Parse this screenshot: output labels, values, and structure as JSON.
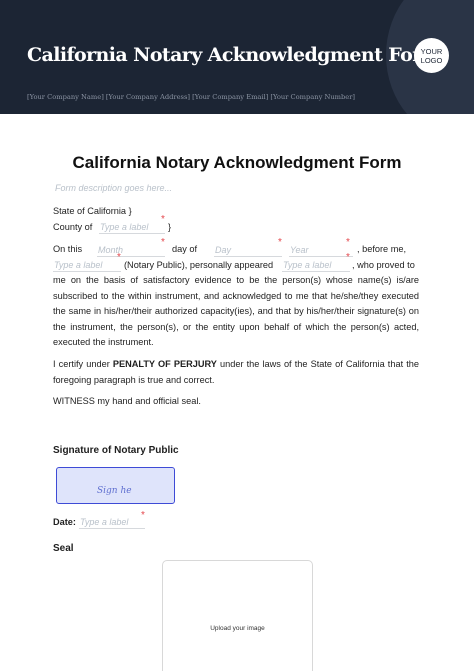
{
  "header": {
    "title": "California Notary Acknowledgment Form",
    "subtitle": "[Your Company Name] [Your Company Address] [Your Company Email] [Your Company Number]",
    "logo_line1": "YOUR",
    "logo_line2": "LOGO"
  },
  "form": {
    "title": "California Notary Acknowledgment Form",
    "description_placeholder": "Form description goes here...",
    "state_line": "State of California }",
    "county_label": "County of",
    "county_close": "}",
    "field_placeholder": "Type a label",
    "on_this": "On this",
    "month_placeholder": "Month",
    "day_of": "day of",
    "day_placeholder": "Day",
    "year_placeholder": "Year",
    "before_me": ", before me,",
    "notary_public": "(Notary Public), personally appeared",
    "who_proved": ", who proved to",
    "body_text": "me on the basis of satisfactory evidence to be the person(s) whose name(s) is/are subscribed to the within instrument, and acknowledged to me that he/she/they executed the same in his/her/their authorized capacity(ies), and that by his/her/their signature(s) on the instrument, the person(s), or the entity upon behalf of which the person(s) acted, executed the instrument.",
    "certify_pre": "I certify under ",
    "certify_bold": "PENALTY OF PERJURY",
    "certify_post": " under the laws of the State of California that the foregoing paragraph is true and correct.",
    "witness": "WITNESS my hand and official seal.",
    "required_mark": "*"
  },
  "signature": {
    "heading": "Signature of Notary Public",
    "sign_text": "Sign he"
  },
  "date": {
    "label": "Date:",
    "placeholder": "Type a label"
  },
  "seal": {
    "heading": "Seal",
    "upload_text": "Upload your image"
  }
}
